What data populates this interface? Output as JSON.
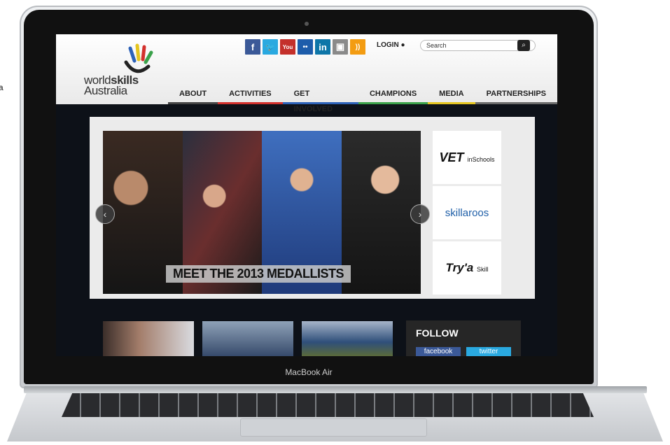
{
  "edge_label": "a",
  "device": {
    "brand": "MacBook Air"
  },
  "site": {
    "logo": {
      "word1": "world",
      "word2": "skills",
      "word3": "Australia"
    },
    "social": [
      {
        "name": "facebook-icon",
        "glyph": "f",
        "color": "#3b5998"
      },
      {
        "name": "twitter-icon",
        "glyph": "🐦",
        "color": "#2aa9e0"
      },
      {
        "name": "youtube-icon",
        "glyph": "You",
        "color": "#c4302b"
      },
      {
        "name": "flickr-icon",
        "glyph": "••",
        "color": "#1d5dab"
      },
      {
        "name": "linkedin-icon",
        "glyph": "in",
        "color": "#0e76a8"
      },
      {
        "name": "photo-icon",
        "glyph": "▣",
        "color": "#8a8a8a"
      },
      {
        "name": "rss-icon",
        "glyph": "))",
        "color": "#f39c12"
      }
    ],
    "login": "LOGIN ●",
    "search": {
      "placeholder": "Search"
    },
    "nav": [
      {
        "label": "ABOUT",
        "color": "#444444"
      },
      {
        "label": "ACTIVITIES",
        "color": "#d3312d"
      },
      {
        "label": "GET INVOLVED",
        "color": "#2d62b8"
      },
      {
        "label": "CHAMPIONS",
        "color": "#3aa14a"
      },
      {
        "label": "MEDIA",
        "color": "#e4c520"
      },
      {
        "label": "PARTNERSHIPS",
        "color": "#6a6a6a"
      }
    ],
    "hero": {
      "caption": "MEET THE 2013 MEDALLISTS"
    },
    "partners": {
      "vet": {
        "main": "VET",
        "sub": "inSchools"
      },
      "roos": {
        "main": "skillaroos"
      },
      "try": {
        "main": "Try'a",
        "sub": "Skill"
      }
    },
    "follow": {
      "title": "FOLLOW",
      "facebook": "facebook",
      "twitter": "twitter"
    }
  }
}
